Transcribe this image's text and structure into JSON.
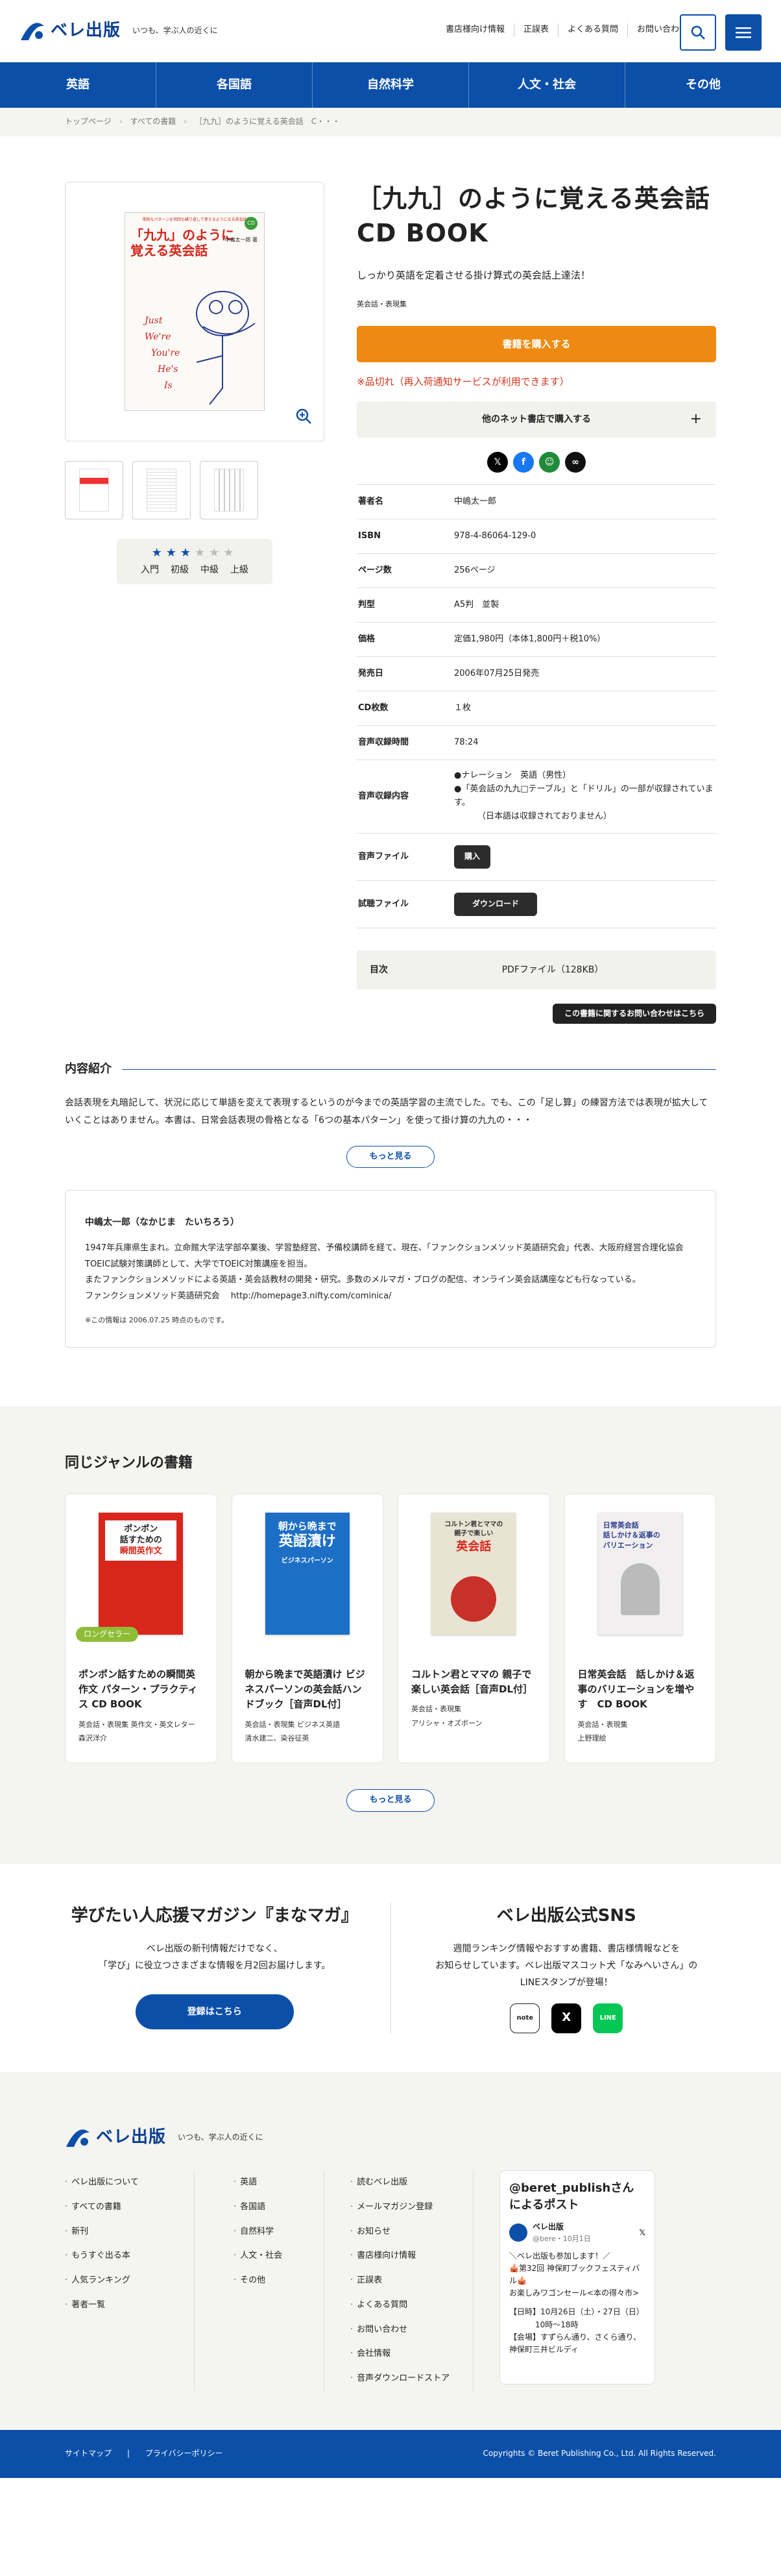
{
  "header": {
    "logo_text": "ベレ出版",
    "tagline": "いつも、学ぶ人の近くに",
    "links": [
      "書店様向け情報",
      "正誤表",
      "よくある質問",
      "お問い合わせ"
    ]
  },
  "nav": [
    "英語",
    "各国語",
    "自然科学",
    "人文・社会",
    "その他"
  ],
  "breadcrumb": [
    "トップページ",
    "すべての書籍",
    "［九九］のように覚える英会話　C・・・"
  ],
  "product": {
    "title": "［九九］のように覚える英会話 CD BOOK",
    "subtitle": "しっかり英語を定着させる掛け算式の英会話上達法！",
    "genre": "英会話・表現集",
    "buy_label": "書籍を購入する",
    "out_of_stock": "※品切れ（再入荷通知サービスが利用できます）",
    "other_shops": "他のネット書店で購入する",
    "level_labels": [
      "入門",
      "初級",
      "中級",
      "上級"
    ],
    "level": 3,
    "level_max": 6,
    "cover": {
      "top_text": "単純なパターンを何回も繰り返して使えるようになる英会話",
      "title_l1": "「九九」のように",
      "title_l2": "覚える英会話",
      "author": "中嶋太一郎 著"
    },
    "specs": [
      {
        "k": "著者名",
        "v": "中嶋太一郎"
      },
      {
        "k": "ISBN",
        "v": "978-4-86064-129-0"
      },
      {
        "k": "ページ数",
        "v": "256ページ"
      },
      {
        "k": "判型",
        "v": "A5判　並製"
      },
      {
        "k": "価格",
        "v": "定価1,980円（本体1,800円＋税10%）"
      },
      {
        "k": "発売日",
        "v": "2006年07月25日発売"
      },
      {
        "k": "CD枚数",
        "v": "１枚"
      },
      {
        "k": "音声収録時間",
        "v": "78:24"
      }
    ],
    "audio_contents_label": "音声収録内容",
    "audio_contents": [
      "●ナレーション　英語（男性）",
      "●「英会話の九九□テーブル」と「ドリル」の一部が収録されています。",
      "（日本語は収録されておりません）"
    ],
    "audio_file_label": "音声ファイル",
    "audio_file_btn": "購入",
    "trial_file_label": "試聴ファイル",
    "trial_file_btn": "ダウンロード",
    "toc_label": "目次",
    "toc_value": "PDFファイル（128KB）",
    "inquiry": "この書籍に関するお問い合わせはこちら"
  },
  "intro": {
    "heading": "内容紹介",
    "text": "会話表現を丸暗記して、状況に応じて単語を変えて表現するというのが今までの英語学習の主流でした。でも、この「足し算」の練習方法では表現が拡大していくことはありません。本書は、日常会話表現の骨格となる「6つの基本パターン」を使って掛け算の九九の・・・",
    "more": "もっと見る"
  },
  "author": {
    "name": "中嶋太一郎（なかじま　たいちろう）",
    "bio": [
      "1947年兵庫県生まれ。立命館大学法学部卒業後、学習塾経営、予備校講師を経て、現在、「ファンクションメソッド英語研究会」代表、大阪府経営合理化協会TOEIC試験対策講師として、大学でTOEIC対策講座を担当。",
      "またファンクションメソッドによる英語・英会話教材の開発・研究。多数のメルマガ・ブログの配信、オンライン英会話講座なども行なっている。",
      "ファンクションメソッド英語研究会　 http://homepage3.nifty.com/cominica/"
    ],
    "note": "※この情報は 2006.07.25 時点のものです。"
  },
  "related": {
    "heading": "同じジャンルの書籍",
    "more": "もっと見る",
    "books": [
      {
        "badge": "ロングセラー",
        "title": "ポンポン話すための瞬間英作文 パターン・プラクティス CD BOOK",
        "genre": "英会話・表現集 英作文・英文レター",
        "author": "森沢洋介",
        "cover_l1": "ポンポン",
        "cover_l2": "話すための",
        "cover_l3": "瞬間英作文",
        "color": "#d9261c"
      },
      {
        "badge": "",
        "title": "朝から晩まで英語漬け ビジネスパーソンの英会話ハンドブック［音声DL付］",
        "genre": "英会話・表現集 ビジネス英語",
        "author": "清水建二、染谷征英",
        "cover_l1": "朝から晩まで",
        "cover_l2": "英語漬け",
        "cover_l3": "ビジネスパーソン",
        "color": "#1d6fc6"
      },
      {
        "badge": "",
        "title": "コルトン君とママの 親子で楽しい英会話［音声DL付］",
        "genre": "英会話・表現集",
        "author": "アリシャ・オズボーン",
        "cover_l1": "コルトン君とママの",
        "cover_l2": "親子で楽しい",
        "cover_l3": "英会話",
        "color": "#e9e3d3"
      },
      {
        "badge": "",
        "title": "日常英会話　話しかけ＆返事のバリエーションを増やす　CD BOOK",
        "genre": "英会話・表現集",
        "author": "上野理絵",
        "cover_l1": "日常英会話",
        "cover_l2": "話しかけ＆返事の",
        "cover_l3": "バリエーション",
        "color": "#f2eff0"
      }
    ]
  },
  "promo": {
    "magazine_heading": "学びたい人応援マガジン『まなマガ』",
    "magazine_text": [
      "ベレ出版の新刊情報だけでなく、",
      "「学び」に役立つさまざまな情報を月2回お届けします。"
    ],
    "register": "登録はこちら",
    "sns_heading": "ベレ出版公式SNS",
    "sns_text": [
      "週間ランキング情報やおすすめ書籍、書店様情報などを",
      "お知らせしています。ベレ出版マスコット犬「なみへいさん」の",
      "LINEスタンプが登場！"
    ],
    "sns_icons": [
      "note",
      "X",
      "LINE"
    ]
  },
  "footer": {
    "col1": [
      "ベレ出版について",
      "すべての書籍",
      "新刊",
      "もうすぐ出る本",
      "人気ランキング",
      "著者一覧"
    ],
    "col2": [
      "英語",
      "各国語",
      "自然科学",
      "人文・社会",
      "その他"
    ],
    "col3": [
      "読むベレ出版",
      "メールマガジン登録",
      "お知らせ",
      "書店様向け情報",
      "正誤表",
      "よくある質問",
      "お問い合わせ",
      "会社情報",
      "音声ダウンロードストア"
    ],
    "twitter_head": "@beret_publishさんによるポスト",
    "tweet_name": "ベレ出版",
    "tweet_handle": "@bere・10月1日",
    "tweet_text": [
      "＼ベレ出版も参加します！／",
      "🎪第32回 神保町ブックフェスティバル🎪",
      "お楽しみワゴンセール<本の得々市>",
      "【日時】10月26日（土）・27日（日）",
      "10時〜18時",
      "【会場】すずらん通り、さくら通り、神保町三井ビルディ"
    ],
    "bottom_links": [
      "サイトマップ",
      "プライバシーポリシー"
    ],
    "copyright": "Copyrights © Beret Publishing Co., Ltd. All Rights Reserved."
  }
}
